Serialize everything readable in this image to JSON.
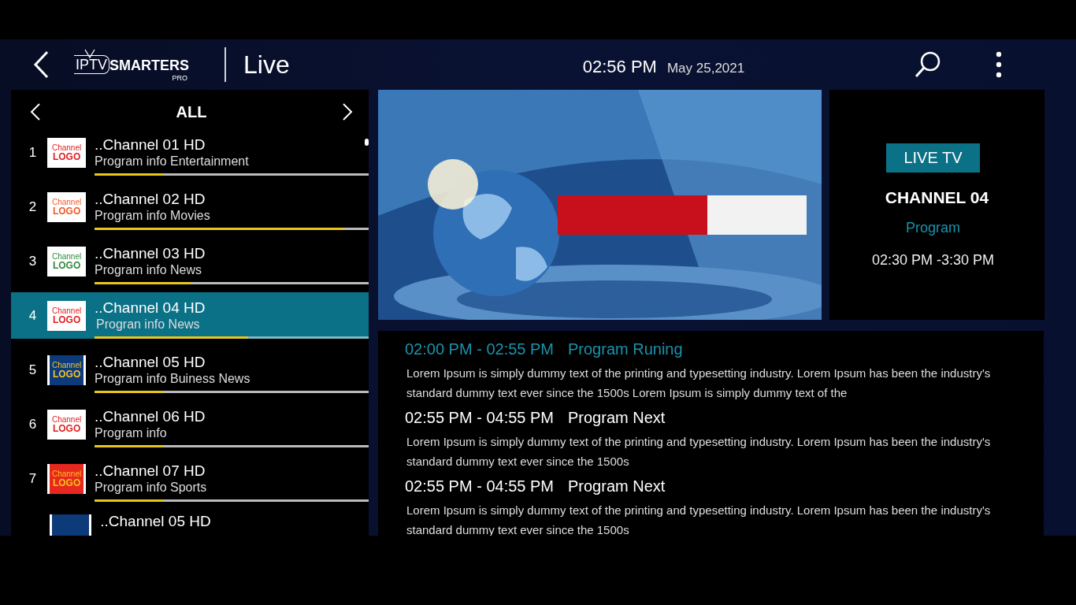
{
  "header": {
    "logo": {
      "prefix": "IPTV",
      "name": "SMARTERS",
      "suffix": "PRO"
    },
    "title": "Live",
    "time": "02:56 PM",
    "date": "May 25,2021"
  },
  "channel_list": {
    "category": "ALL",
    "channels": [
      {
        "number": "1",
        "logo_lines": [
          "Channel",
          "LOGO"
        ],
        "kind": "white",
        "color": "#e02020",
        "name": "..Channel 01 HD",
        "program": "Program info Entertainment",
        "level": 0.25,
        "selected": false
      },
      {
        "number": "2",
        "logo_lines": [
          "Channel",
          "LOGO"
        ],
        "kind": "white",
        "color": "#f05a28",
        "name": "..Channel 02 HD",
        "program": "Program info Movies",
        "level": 0.91,
        "selected": false
      },
      {
        "number": "3",
        "logo_lines": [
          "Channel",
          "LOGO"
        ],
        "kind": "white",
        "color": "#2e8b3a",
        "name": "..Channel 03 HD",
        "program": "Program info News",
        "level": 0.35,
        "selected": false
      },
      {
        "number": "4",
        "logo_lines": [
          "Channel",
          "LOGO"
        ],
        "kind": "white",
        "color": "#e02020",
        "name": "..Channel 04 HD",
        "program": "Progran info News",
        "level": 0.56,
        "selected": true
      },
      {
        "number": "5",
        "logo_lines": [
          "Channel",
          "LOGO"
        ],
        "kind": "navy",
        "color": "#f2c230",
        "name": "..Channel 05 HD",
        "program": "Program info Buiness News",
        "level": 0.25,
        "selected": false
      },
      {
        "number": "6",
        "logo_lines": [
          "Channel",
          "LOGO"
        ],
        "kind": "white",
        "color": "#e02020",
        "name": "..Channel 06 HD",
        "program": "Program info",
        "level": 0.25,
        "selected": false
      },
      {
        "number": "7",
        "logo_lines": [
          "Channel",
          "LOGO"
        ],
        "kind": "red",
        "color": "#f7c21a",
        "name": "..Channel 07 HD",
        "program": "Program info Sports",
        "level": 0.25,
        "selected": false
      },
      {
        "kind": "navy",
        "name": "..Channel 05 HD",
        "selected": false
      }
    ]
  },
  "now_playing": {
    "badge": "LIVE TV",
    "channel": "CHANNEL 04",
    "program": "Program",
    "time": "02:30 PM -3:30 PM"
  },
  "epg": [
    {
      "time": "02:00 PM -  02:55 PM",
      "title": "Program Runing",
      "current": true,
      "description": "Lorem Ipsum is simply dummy text of the printing and typesetting industry. Lorem Ipsum has been the industry's standard dummy text ever since the 1500s Lorem Ipsum is simply dummy text of the"
    },
    {
      "time": "02:55 PM -  04:55 PM",
      "title": "Program Next",
      "current": false,
      "description": "Lorem Ipsum is simply dummy text of the printing and typesetting industry. Lorem Ipsum has been the industry's standard dummy text ever since the 1500s"
    },
    {
      "time": "02:55 PM -  04:55 PM",
      "title": "Program Next",
      "current": false,
      "description": "Lorem Ipsum is simply dummy text of the printing and typesetting industry. Lorem Ipsum has been the industry's standard dummy text ever since the 1500s"
    }
  ]
}
